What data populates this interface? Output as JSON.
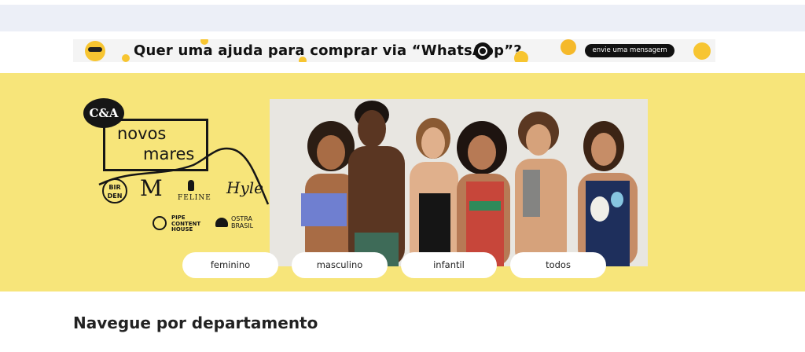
{
  "whatsapp_banner": {
    "headline": "Quer uma ajuda para comprar via “WhatsApp”?",
    "button_label": "envie uma mensagem"
  },
  "hero": {
    "brand_badge": "C&A",
    "collection_line1": "novos",
    "collection_line2": "mares",
    "partner_brands": {
      "birden_top": "BIR",
      "birden_bottom": "DEN",
      "m_logo": "M",
      "feline": "FELINE",
      "hyle": "Hyle",
      "pipe_1": "PIPE",
      "pipe_2": "CONTENT",
      "pipe_3": "HOUSE",
      "ostra_1": "OSTRA",
      "ostra_2": "BRASIL"
    },
    "category_buttons": [
      "feminino",
      "masculino",
      "infantil",
      "todos"
    ]
  },
  "sections": {
    "departments_title": "Navegue por departamento"
  },
  "colors": {
    "hero_background": "#f7e57a",
    "top_strip": "#eceff7",
    "button_dark": "#111111"
  }
}
